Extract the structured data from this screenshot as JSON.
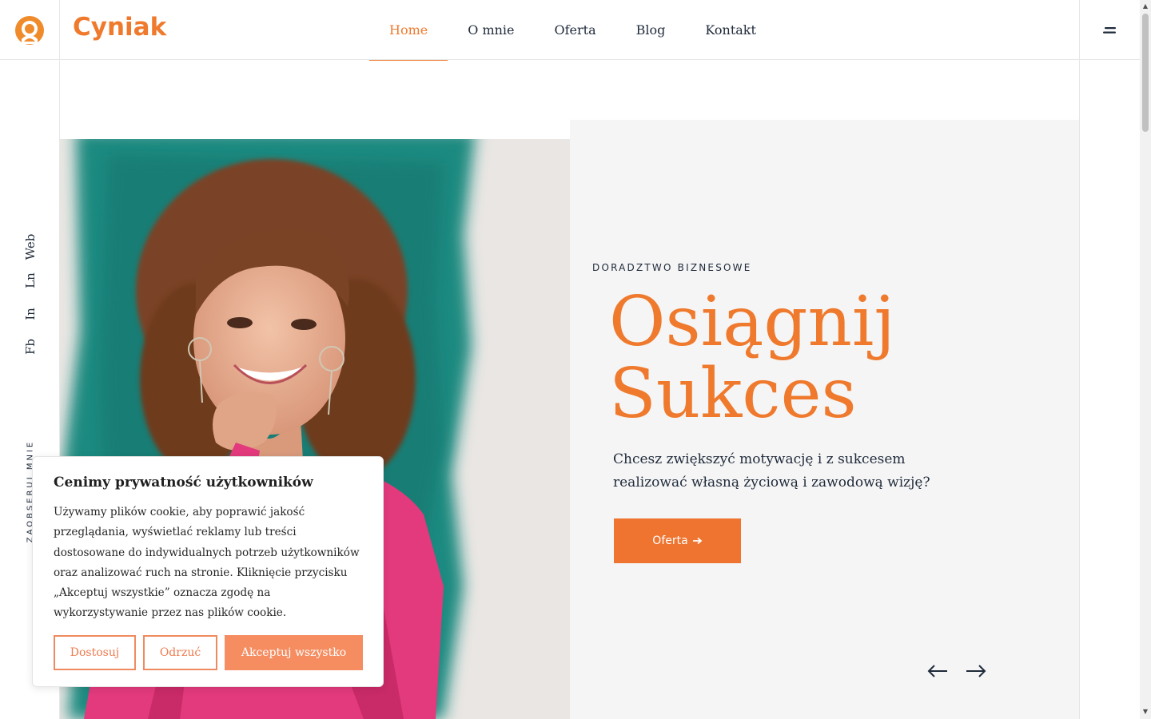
{
  "header": {
    "brand": "Cyniak",
    "nav": [
      {
        "label": "Home",
        "active": true
      },
      {
        "label": "O mnie"
      },
      {
        "label": "Oferta"
      },
      {
        "label": "Blog"
      },
      {
        "label": "Kontakt"
      }
    ],
    "logo_icon": "avatar-logo-icon",
    "menu_icon": "hamburger-menu-icon"
  },
  "sidebar": {
    "social": [
      "Web",
      "Ln",
      "In",
      "Fb"
    ],
    "follow_label": "ZAOBSERUJ MNIE"
  },
  "hero": {
    "eyebrow": "DORADZTWO BIZNESOWE",
    "headline_line1": "Osiągnij",
    "headline_line2": "Sukces",
    "subtitle": "Chcesz zwiększyć motywację i z sukcesem realizować własną życiową i zawodową wizję?",
    "cta_label": "Oferta",
    "cta_icon": "arrow-right-icon",
    "prev_icon": "arrow-left-icon",
    "next_icon": "arrow-right-icon"
  },
  "cookie": {
    "title": "Cenimy prywatność użytkowników",
    "text": "Używamy plików cookie, aby poprawić jakość przeglądania, wyświetlać reklamy lub treści dostosowane do indywidualnych potrzeb użytkowników oraz analizować ruch na stronie. Kliknięcie przycisku „Akceptuj wszystkie” oznacza zgodę na wykorzystywanie przez nas plików cookie.",
    "buttons": {
      "customize": "Dostosuj",
      "reject": "Odrzuć",
      "accept": "Akceptuj wszystko"
    }
  },
  "colors": {
    "accent": "#ef7a2e",
    "cta": "#ee7430",
    "accept_button": "#f58d61",
    "panel": "#f5f5f5",
    "text": "#1f2a3a"
  }
}
